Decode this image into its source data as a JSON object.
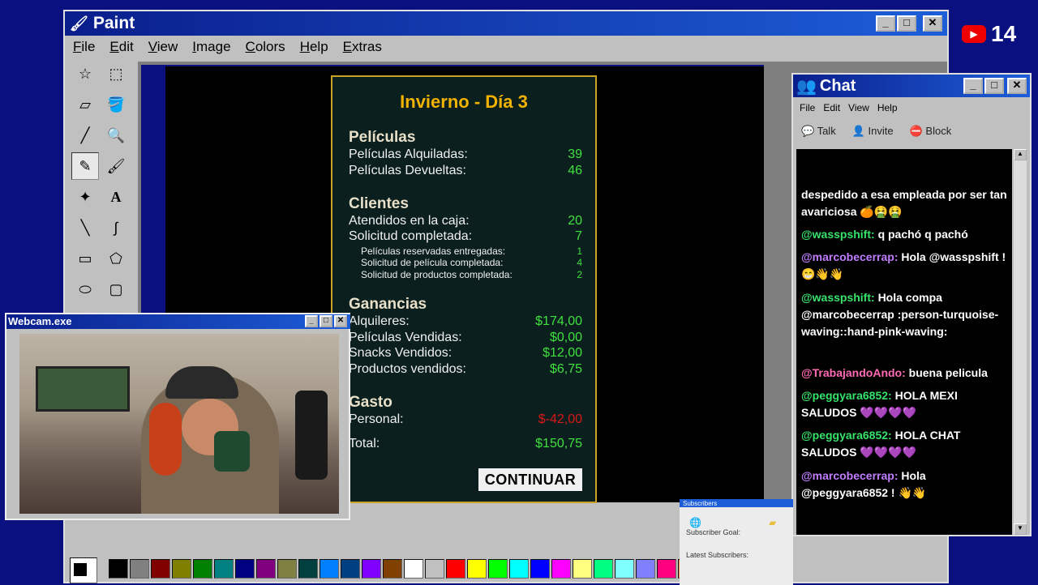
{
  "paint": {
    "title": "Paint",
    "menu": [
      "File",
      "Edit",
      "View",
      "Image",
      "Colors",
      "Help",
      "Extras"
    ],
    "palette": [
      "#000000",
      "#808080",
      "#800000",
      "#808000",
      "#008000",
      "#008080",
      "#000080",
      "#800080",
      "#808040",
      "#004040",
      "#0080ff",
      "#004080",
      "#8000ff",
      "#804000",
      "#ffffff",
      "#c0c0c0",
      "#ff0000",
      "#ffff00",
      "#00ff00",
      "#00ffff",
      "#0000ff",
      "#ff00ff",
      "#ffff80",
      "#00ff80",
      "#80ffff",
      "#8080ff",
      "#ff0080",
      "#ff8040"
    ]
  },
  "summary": {
    "title": "Invierno - Día 3",
    "peliculas": {
      "heading": "Películas",
      "rows": [
        {
          "label": "Películas Alquiladas:",
          "value": "39"
        },
        {
          "label": "Películas Devueltas:",
          "value": "46"
        }
      ]
    },
    "clientes": {
      "heading": "Clientes",
      "rows": [
        {
          "label": "Atendidos en la caja:",
          "value": "20"
        },
        {
          "label": "Solicitud completada:",
          "value": "7"
        }
      ],
      "sub": [
        {
          "label": "Películas reservadas entregadas:",
          "value": "1"
        },
        {
          "label": "Solicitud de película completada:",
          "value": "4"
        },
        {
          "label": "Solicitud de productos completada:",
          "value": "2"
        }
      ]
    },
    "ganancias": {
      "heading": "Ganancias",
      "rows": [
        {
          "label": "Alquileres:",
          "value": "$174,00"
        },
        {
          "label": "Películas Vendidas:",
          "value": "$0,00"
        },
        {
          "label": "Snacks Vendidos:",
          "value": "$12,00"
        },
        {
          "label": "Productos vendidos:",
          "value": "$6,75"
        }
      ]
    },
    "gasto": {
      "heading": "Gasto",
      "rows": [
        {
          "label": "Personal:",
          "value": "$-42,00"
        }
      ]
    },
    "total": {
      "label": "Total:",
      "value": "$150,75"
    },
    "button": "CONTINUAR"
  },
  "chat": {
    "title": "Chat",
    "menu": [
      "File",
      "Edit",
      "View",
      "Help"
    ],
    "toolbar": [
      "Talk",
      "Invite",
      "Block"
    ],
    "messages": [
      {
        "user": "",
        "text": "despedido a esa empleada por ser tan avariciosa 🍊🤮🤮"
      },
      {
        "user": "@wasspshift:",
        "text": "q pachó q pachó"
      },
      {
        "user": "@marcobecerrap:",
        "text": "Hola @wasspshift ! 😁👋👋"
      },
      {
        "user": "@wasspshift:",
        "text": "Hola compa @marcobecerrap :person-turquoise-waving::hand-pink-waving:"
      },
      {
        "user": "@TrabajandoAndo:",
        "text": "buena pelicula"
      },
      {
        "user": "@peggyara6852:",
        "text": "HOLA MEXI SALUDOS 💜💜💜💜"
      },
      {
        "user": "@peggyara6852:",
        "text": "HOLA CHAT SALUDOS 💜💜💜💜"
      },
      {
        "user": "@marcobecerrap:",
        "text": "Hola @peggyara6852 ! 👋👋"
      }
    ]
  },
  "webcam": {
    "title": "Webcam.exe"
  },
  "subscribers": {
    "title": "Subscribers",
    "goal": "Subscriber Goal:",
    "latest": "Latest Subscribers:"
  },
  "youtube": {
    "count": "14"
  }
}
